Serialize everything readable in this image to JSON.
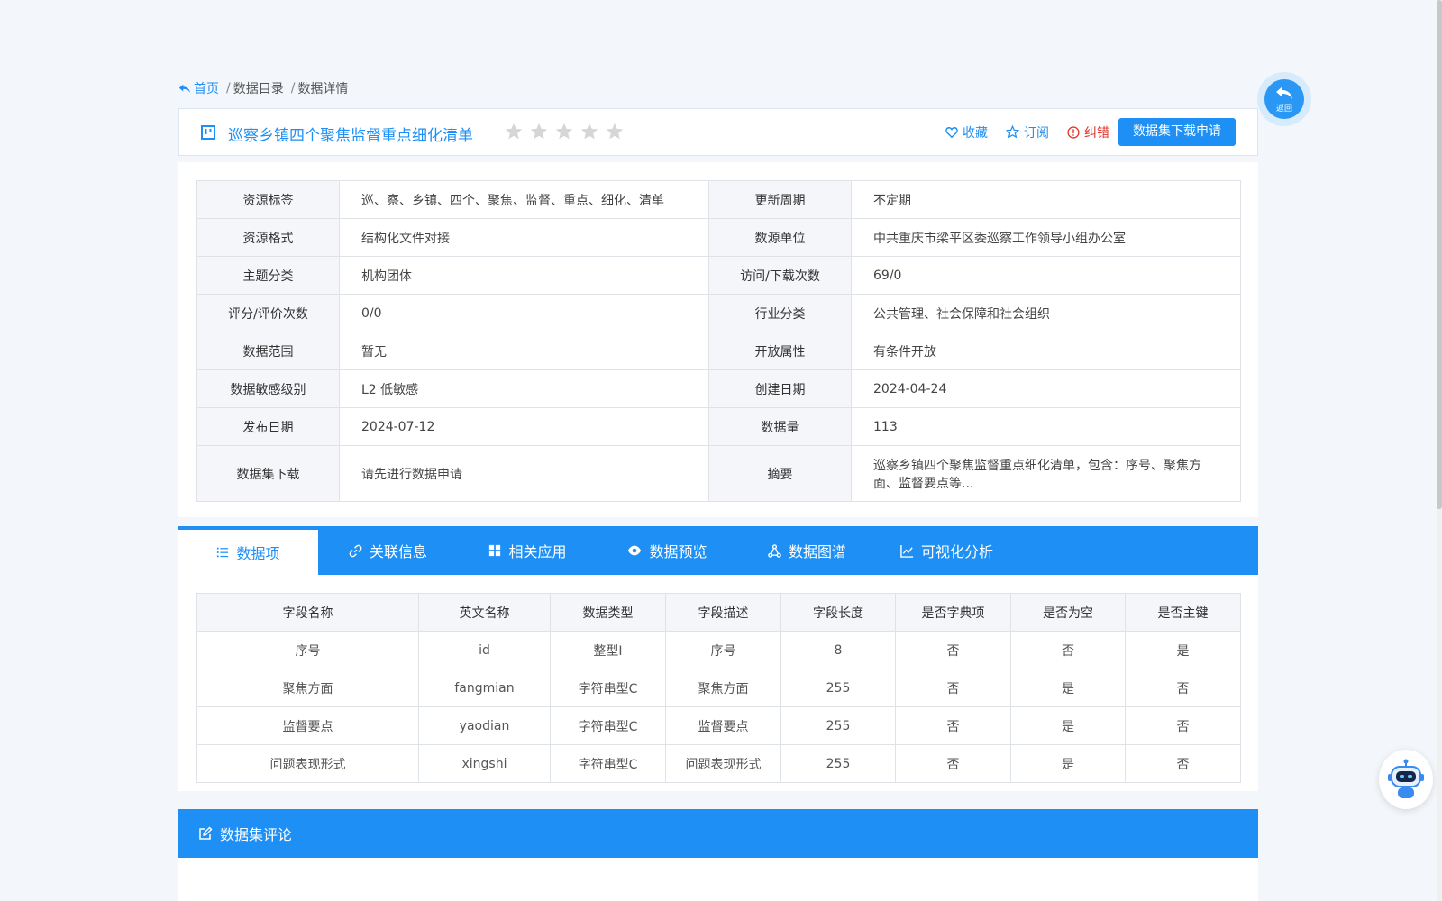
{
  "breadcrumb": {
    "home": "首页",
    "sep": "/",
    "catalog": "数据目录",
    "detail": "数据详情"
  },
  "title": {
    "text": "巡察乡镇四个聚焦监督重点细化清单",
    "rating_stars": 0,
    "favorite": "收藏",
    "subscribe": "订阅",
    "report_error": "纠错",
    "apply_button": "数据集下载申请"
  },
  "info": {
    "rows": [
      {
        "l1": "资源标签",
        "v1": "巡、察、乡镇、四个、聚焦、监督、重点、细化、清单",
        "l2": "更新周期",
        "v2": "不定期"
      },
      {
        "l1": "资源格式",
        "v1": "结构化文件对接",
        "l2": "数源单位",
        "v2": "中共重庆市梁平区委巡察工作领导小组办公室"
      },
      {
        "l1": "主题分类",
        "v1": "机构团体",
        "l2": "访问/下载次数",
        "v2": "69/0"
      },
      {
        "l1": "评分/评价次数",
        "v1": "0/0",
        "l2": "行业分类",
        "v2": "公共管理、社会保障和社会组织"
      },
      {
        "l1": "数据范围",
        "v1": "暂无",
        "l2": "开放属性",
        "v2": "有条件开放"
      },
      {
        "l1": "数据敏感级别",
        "v1": "L2 低敏感",
        "l2": "创建日期",
        "v2": "2024-04-24"
      },
      {
        "l1": "发布日期",
        "v1": "2024-07-12",
        "l2": "数据量",
        "v2": "113"
      },
      {
        "l1": "数据集下载",
        "v1": "请先进行数据申请",
        "l2": "摘要",
        "v2": "巡察乡镇四个聚焦监督重点细化清单，包含：序号、聚焦方面、监督要点等..."
      }
    ]
  },
  "tabs": [
    {
      "label": "数据项",
      "icon": "list-icon",
      "active": true
    },
    {
      "label": "关联信息",
      "icon": "link-icon"
    },
    {
      "label": "相关应用",
      "icon": "grid-icon"
    },
    {
      "label": "数据预览",
      "icon": "eye-icon"
    },
    {
      "label": "数据图谱",
      "icon": "graph-icon"
    },
    {
      "label": "可视化分析",
      "icon": "line-chart-icon"
    }
  ],
  "fields": {
    "headers": [
      "字段名称",
      "英文名称",
      "数据类型",
      "字段描述",
      "字段长度",
      "是否字典项",
      "是否为空",
      "是否主键"
    ],
    "rows": [
      [
        "序号",
        "id",
        "整型I",
        "序号",
        "8",
        "否",
        "否",
        "是"
      ],
      [
        "聚焦方面",
        "fangmian",
        "字符串型C",
        "聚焦方面",
        "255",
        "否",
        "是",
        "否"
      ],
      [
        "监督要点",
        "yaodian",
        "字符串型C",
        "监督要点",
        "255",
        "否",
        "是",
        "否"
      ],
      [
        "问题表现形式",
        "xingshi",
        "字符串型C",
        "问题表现形式",
        "255",
        "否",
        "是",
        "否"
      ]
    ]
  },
  "comments": {
    "title": "数据集评论"
  },
  "fab": {
    "back_label": "返回"
  },
  "colors": {
    "accent": "#1e8ff5",
    "error": "#e0332b",
    "label_bg": "#f4f6f9",
    "page_bg": "#f3f6fa"
  }
}
